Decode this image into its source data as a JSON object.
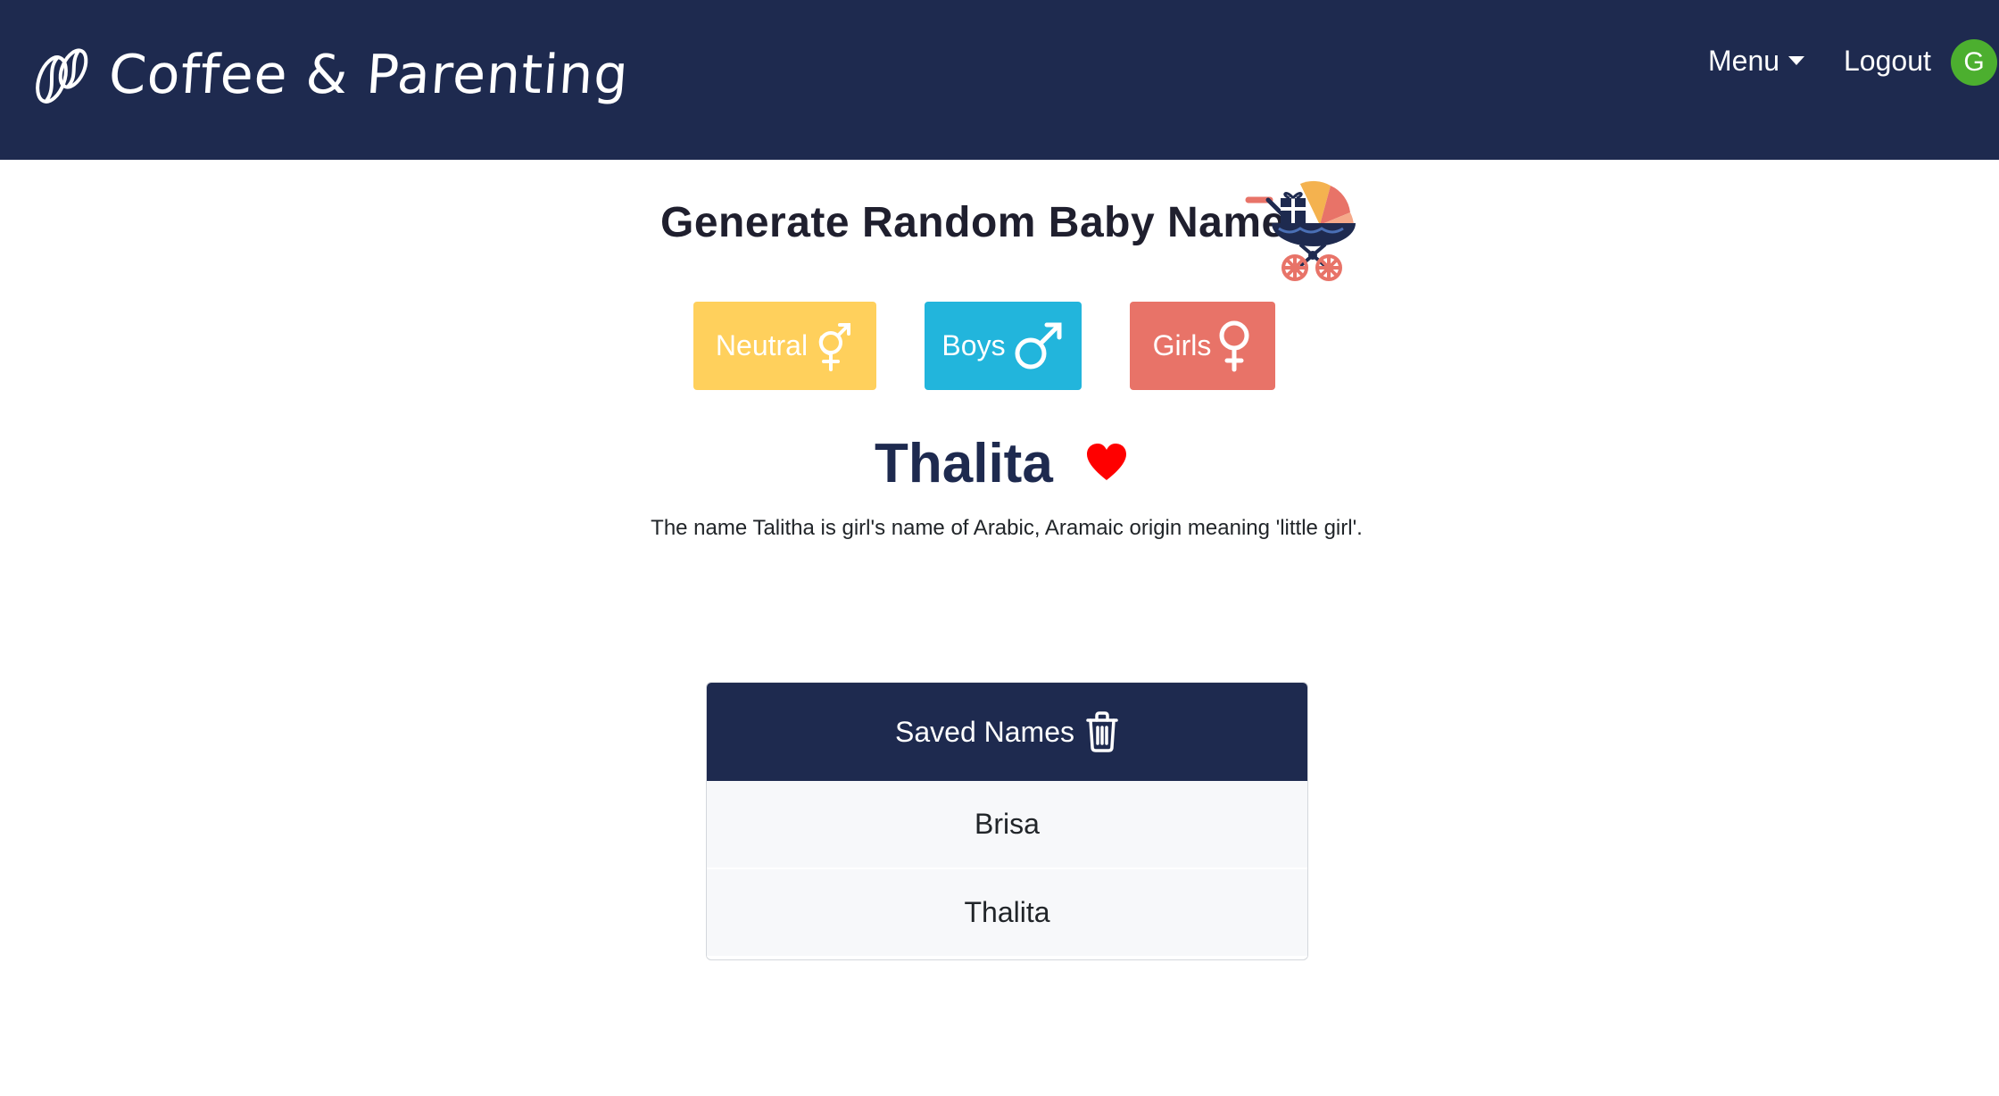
{
  "navbar": {
    "brand": "Coffee & Parenting",
    "menu_label": "Menu",
    "logout_label": "Logout",
    "avatar_initial": "G",
    "bg_color": "#1e2a4f"
  },
  "main": {
    "heading": "Generate Random Baby Name",
    "buttons": [
      {
        "label": "Neutral",
        "icon": "genderless-symbol-icon",
        "color": "#ffd05c"
      },
      {
        "label": "Boys",
        "icon": "male-symbol-icon",
        "color": "#22b5dc"
      },
      {
        "label": "Girls",
        "icon": "female-symbol-icon",
        "color": "#e87368"
      }
    ],
    "generated_name": "Thalita",
    "meaning": "The name Talitha is girl's name of Arabic, Aramaic origin meaning 'little girl'.",
    "favorite_icon": "heart-icon"
  },
  "saved": {
    "title": "Saved Names",
    "trash_icon": "trash-icon",
    "names": [
      "Brisa",
      "Thalita"
    ]
  }
}
